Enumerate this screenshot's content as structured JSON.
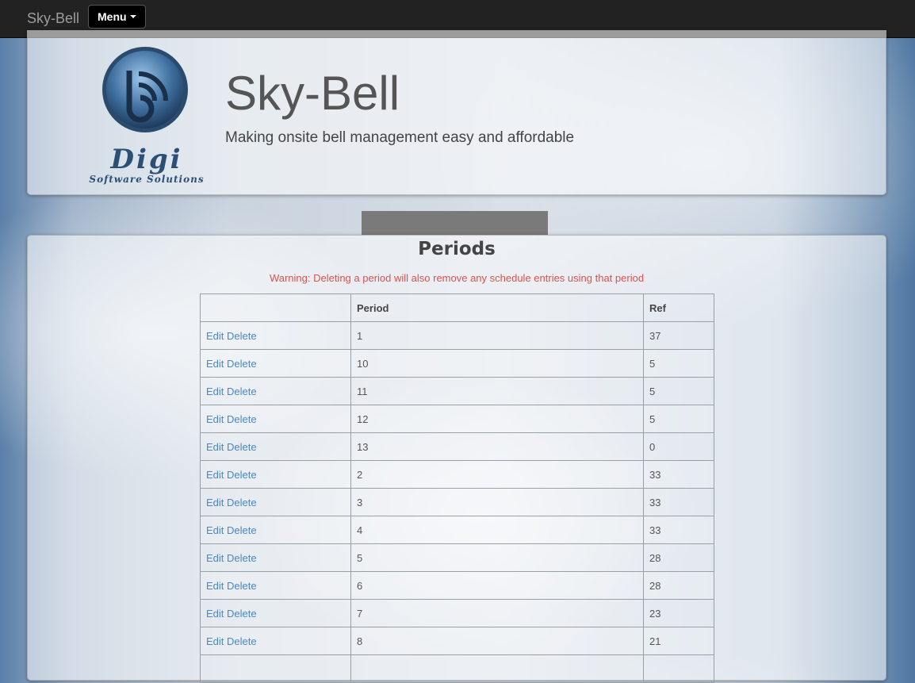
{
  "navbar": {
    "brand": "Sky-Bell",
    "menu_label": "Menu"
  },
  "header": {
    "title": "Sky-Bell",
    "tagline": "Making onsite bell management easy and affordable",
    "logo": {
      "name": "Digi",
      "subtitle": "Software Solutions"
    }
  },
  "section": {
    "title": "Periods",
    "warning": "Warning: Deleting a period will also remove any schedule entries using that period"
  },
  "table": {
    "headers": [
      "",
      "Period",
      "Ref"
    ],
    "edit_label": "Edit",
    "delete_label": "Delete",
    "rows": [
      {
        "period": "1",
        "ref": "37"
      },
      {
        "period": "10",
        "ref": "5"
      },
      {
        "period": "11",
        "ref": "5"
      },
      {
        "period": "12",
        "ref": "5"
      },
      {
        "period": "13",
        "ref": "0"
      },
      {
        "period": "2",
        "ref": "33"
      },
      {
        "period": "3",
        "ref": "33"
      },
      {
        "period": "4",
        "ref": "33"
      },
      {
        "period": "5",
        "ref": "28"
      },
      {
        "period": "6",
        "ref": "28"
      },
      {
        "period": "7",
        "ref": "23"
      },
      {
        "period": "8",
        "ref": "21"
      },
      {
        "period": "",
        "ref": ""
      }
    ]
  },
  "colors": {
    "navbar": "#222222",
    "link": "#4a87c4",
    "warning": "#d9534f"
  }
}
